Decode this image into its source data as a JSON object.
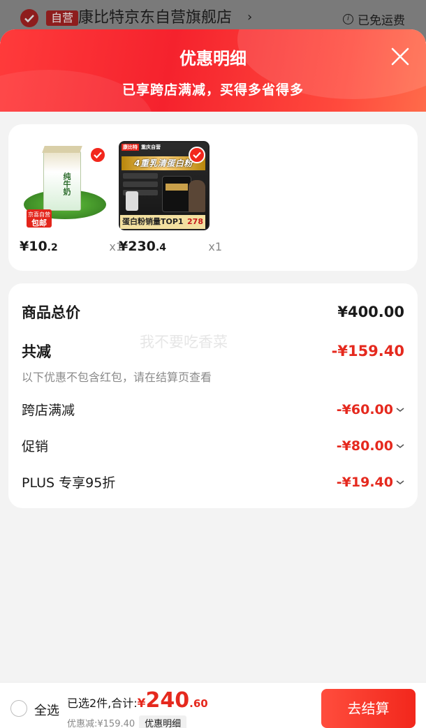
{
  "store": {
    "self_badge": "自营",
    "name": "康比特京东自营旗舰店",
    "arrow": "›",
    "shipping": "已免运费",
    "info_icon": "i"
  },
  "sheet": {
    "title": "优惠明细",
    "subtitle": "已享跨店满减，买得多省得多"
  },
  "products": [
    {
      "price_int": "¥10",
      "price_dec": ".2",
      "qty": "x1",
      "image": "milk-carton",
      "jd_tag_line1": "京喜自营",
      "jd_tag_line2": "包邮",
      "box_label": "纯牛奶"
    },
    {
      "price_int": "¥230",
      "price_dec": ".4",
      "qty": "x1",
      "image": "protein-powder",
      "top_badge": "康比特",
      "top_text": "重庆自营",
      "headline": "4重乳清蛋白粉",
      "bottom_text": "蛋白粉销量TOP1",
      "bottom_num": "278"
    }
  ],
  "summary": {
    "total_label": "商品总价",
    "total_value": "¥400.00",
    "reduce_label": "共减",
    "reduce_value": "-¥159.40",
    "note": "以下优惠不包含红包，请在结算页查看",
    "items": [
      {
        "label": "跨店满减",
        "value": "-¥60.00"
      },
      {
        "label": "促销",
        "value": "-¥80.00"
      },
      {
        "label": "PLUS 专享95折",
        "value": "-¥19.40"
      }
    ]
  },
  "watermark": "我不要吃香菜",
  "bottom": {
    "select_all": "全选",
    "selected_text": "已选2件,合计:",
    "currency": "¥",
    "total_int": "240",
    "total_dec": ".60",
    "discount_text": "优惠减:¥159.40",
    "detail_chip": "优惠明细",
    "checkout": "去结算"
  },
  "colors": {
    "accent_red": "#e5291e",
    "header_red": "#f5222d"
  }
}
